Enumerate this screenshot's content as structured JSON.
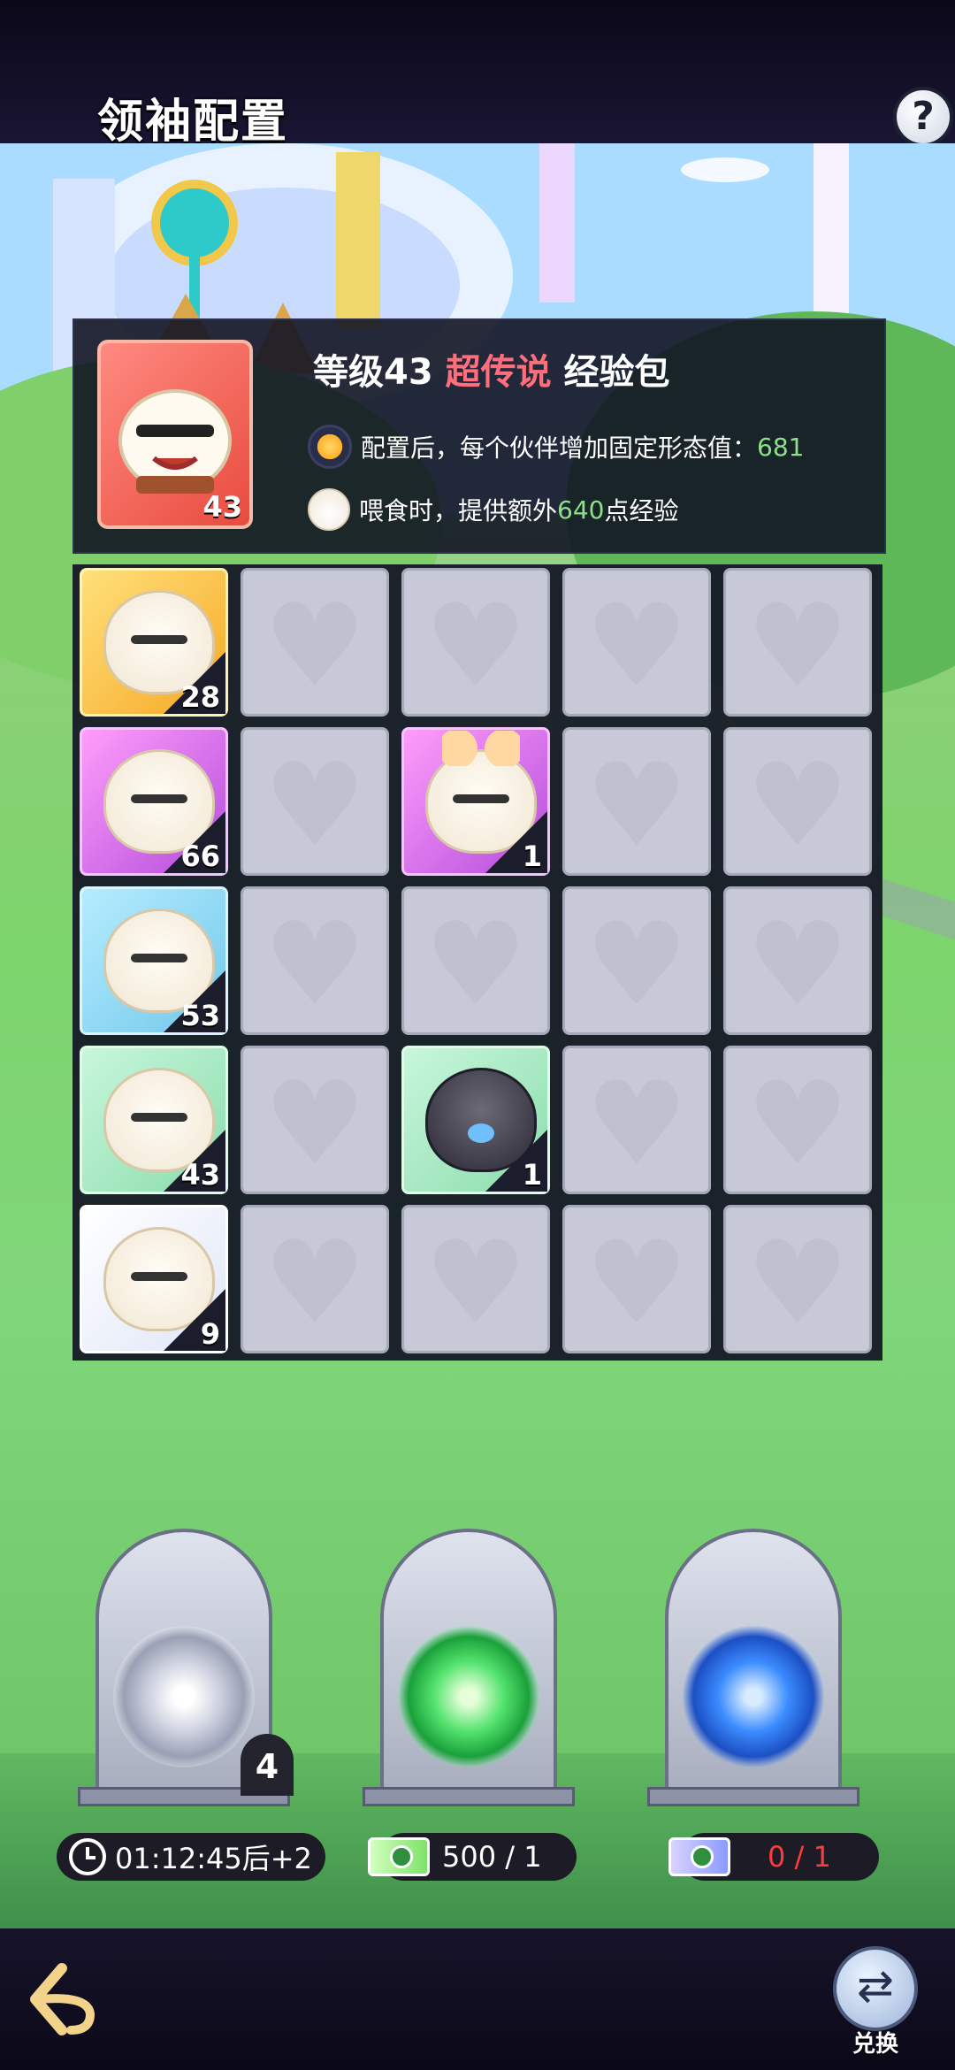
{
  "header": {
    "title": "领袖配置",
    "help_label": "?"
  },
  "info": {
    "level_text": "等级43",
    "rarity": "超传说",
    "item_name": "经验包",
    "icon_level": "43",
    "line1_text": "配置后，每个伙伴增加固定形态值：",
    "line1_value": "681",
    "line2_prefix": "喂食时，提供额外",
    "line2_value": "640",
    "line2_suffix": "点经验"
  },
  "grid": {
    "filled": [
      {
        "row": 0,
        "col": 0,
        "rarity": "gold",
        "count": "28"
      },
      {
        "row": 1,
        "col": 0,
        "rarity": "purple",
        "count": "66"
      },
      {
        "row": 1,
        "col": 2,
        "rarity": "purple",
        "count": "1"
      },
      {
        "row": 2,
        "col": 0,
        "rarity": "blue",
        "count": "53"
      },
      {
        "row": 3,
        "col": 0,
        "rarity": "green",
        "count": "43"
      },
      {
        "row": 3,
        "col": 2,
        "rarity": "green",
        "count": "1"
      },
      {
        "row": 4,
        "col": 0,
        "rarity": "white",
        "count": "9"
      }
    ]
  },
  "portals": {
    "white_badge": "4",
    "timer": "01:12:45后+2",
    "green_count": "500 / 1",
    "blue_count": "0 / 1"
  },
  "footer": {
    "exchange_label": "兑换"
  },
  "colors": {
    "rarity_text": "#ff6e7a",
    "value_green": "#8de08a",
    "count_red": "#ff3b3b"
  },
  "icons": [
    "question-icon",
    "star-icon",
    "bun-icon",
    "clock-icon",
    "green-ticket-icon",
    "blue-ticket-icon",
    "back-arrow-icon",
    "exchange-icon"
  ]
}
